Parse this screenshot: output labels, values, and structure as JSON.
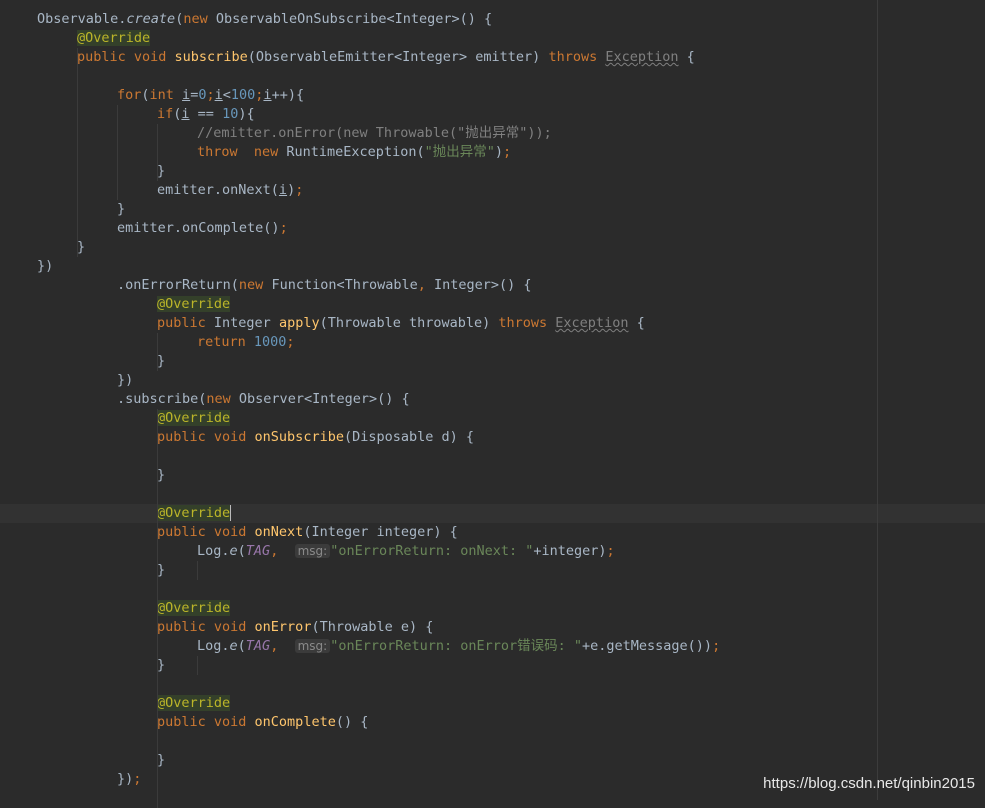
{
  "editor": {
    "lines": [
      {
        "indent": 0,
        "tokens": [
          {
            "t": "cls",
            "s": "Observable."
          },
          {
            "t": "it",
            "s": "create"
          },
          {
            "t": "cls",
            "s": "("
          },
          {
            "t": "kw",
            "s": "new "
          },
          {
            "t": "cls",
            "s": "ObservableOnSubscribe<Integer>() {"
          }
        ]
      },
      {
        "indent": 1,
        "tokens": [
          {
            "t": "ann",
            "s": "@Override"
          }
        ]
      },
      {
        "indent": 1,
        "tokens": [
          {
            "t": "kw",
            "s": "public void "
          },
          {
            "t": "fn",
            "s": "subscribe"
          },
          {
            "t": "cls",
            "s": "(ObservableEmitter<Integer> emitter) "
          },
          {
            "t": "kw",
            "s": "throws "
          },
          {
            "t": "warn",
            "s": "Exception"
          },
          {
            "t": "cls",
            "s": " {"
          }
        ]
      },
      {
        "indent": 0,
        "tokens": []
      },
      {
        "indent": 2,
        "tokens": [
          {
            "t": "kw",
            "s": "for"
          },
          {
            "t": "cls",
            "s": "("
          },
          {
            "t": "kw",
            "s": "int "
          },
          {
            "t": "uvar",
            "s": "i"
          },
          {
            "t": "cls",
            "s": "="
          },
          {
            "t": "num",
            "s": "0"
          },
          {
            "t": "kw",
            "s": ";"
          },
          {
            "t": "uvar",
            "s": "i"
          },
          {
            "t": "cls",
            "s": "<"
          },
          {
            "t": "num",
            "s": "100"
          },
          {
            "t": "kw",
            "s": ";"
          },
          {
            "t": "uvar",
            "s": "i"
          },
          {
            "t": "cls",
            "s": "++){"
          }
        ]
      },
      {
        "indent": 3,
        "tokens": [
          {
            "t": "kw",
            "s": "if"
          },
          {
            "t": "cls",
            "s": "("
          },
          {
            "t": "uvar",
            "s": "i"
          },
          {
            "t": "cls",
            "s": " == "
          },
          {
            "t": "num",
            "s": "10"
          },
          {
            "t": "cls",
            "s": "){"
          }
        ]
      },
      {
        "indent": 4,
        "tokens": [
          {
            "t": "cmt",
            "s": "//emitter.onError(new Throwable(\"抛出异常\"));"
          }
        ]
      },
      {
        "indent": 4,
        "tokens": [
          {
            "t": "kw",
            "s": "throw  new "
          },
          {
            "t": "cls",
            "s": "RuntimeException("
          },
          {
            "t": "str",
            "s": "\"抛出异常\""
          },
          {
            "t": "cls",
            "s": ")"
          },
          {
            "t": "kw",
            "s": ";"
          }
        ]
      },
      {
        "indent": 3,
        "tokens": [
          {
            "t": "cls",
            "s": "}"
          }
        ]
      },
      {
        "indent": 3,
        "tokens": [
          {
            "t": "cls",
            "s": "emitter.onNext("
          },
          {
            "t": "uvar",
            "s": "i"
          },
          {
            "t": "cls",
            "s": ")"
          },
          {
            "t": "kw",
            "s": ";"
          }
        ]
      },
      {
        "indent": 2,
        "tokens": [
          {
            "t": "cls",
            "s": "}"
          }
        ]
      },
      {
        "indent": 2,
        "tokens": [
          {
            "t": "cls",
            "s": "emitter.onComplete()"
          },
          {
            "t": "kw",
            "s": ";"
          }
        ]
      },
      {
        "indent": 1,
        "tokens": [
          {
            "t": "cls",
            "s": "}"
          }
        ]
      },
      {
        "indent": 0,
        "tokens": [
          {
            "t": "cls",
            "s": "})"
          }
        ]
      },
      {
        "indent": 2,
        "tokens": [
          {
            "t": "cls",
            "s": ".onErrorReturn("
          },
          {
            "t": "kw",
            "s": "new "
          },
          {
            "t": "cls",
            "s": "Function<Throwable"
          },
          {
            "t": "kw",
            "s": ", "
          },
          {
            "t": "cls",
            "s": "Integer>() {"
          }
        ]
      },
      {
        "indent": 3,
        "tokens": [
          {
            "t": "ann",
            "s": "@Override"
          }
        ]
      },
      {
        "indent": 3,
        "tokens": [
          {
            "t": "kw",
            "s": "public "
          },
          {
            "t": "cls",
            "s": "Integer "
          },
          {
            "t": "fn",
            "s": "apply"
          },
          {
            "t": "cls",
            "s": "(Throwable throwable) "
          },
          {
            "t": "kw",
            "s": "throws "
          },
          {
            "t": "warn",
            "s": "Exception"
          },
          {
            "t": "cls",
            "s": " {"
          }
        ]
      },
      {
        "indent": 4,
        "tokens": [
          {
            "t": "kw",
            "s": "return "
          },
          {
            "t": "num",
            "s": "1000"
          },
          {
            "t": "kw",
            "s": ";"
          }
        ]
      },
      {
        "indent": 3,
        "tokens": [
          {
            "t": "cls",
            "s": "}"
          }
        ]
      },
      {
        "indent": 2,
        "tokens": [
          {
            "t": "cls",
            "s": "})"
          }
        ]
      },
      {
        "indent": 2,
        "tokens": [
          {
            "t": "cls",
            "s": ".subscribe("
          },
          {
            "t": "kw",
            "s": "new "
          },
          {
            "t": "cls",
            "s": "Observer<Integer>() {"
          }
        ]
      },
      {
        "indent": 3,
        "tokens": [
          {
            "t": "ann",
            "s": "@Override"
          }
        ]
      },
      {
        "indent": 3,
        "tokens": [
          {
            "t": "kw",
            "s": "public void "
          },
          {
            "t": "fn",
            "s": "onSubscribe"
          },
          {
            "t": "cls",
            "s": "(Disposable d) {"
          }
        ]
      },
      {
        "indent": 0,
        "tokens": []
      },
      {
        "indent": 3,
        "tokens": [
          {
            "t": "cls",
            "s": "}"
          }
        ]
      },
      {
        "indent": 0,
        "tokens": []
      },
      {
        "indent": 3,
        "current": true,
        "tokens": [
          {
            "t": "ann",
            "s": "@Override"
          },
          {
            "t": "caret",
            "s": ""
          }
        ]
      },
      {
        "indent": 3,
        "tokens": [
          {
            "t": "kw",
            "s": "public void "
          },
          {
            "t": "fn",
            "s": "onNext"
          },
          {
            "t": "cls",
            "s": "(Integer integer) {"
          }
        ]
      },
      {
        "indent": 4,
        "tokens": [
          {
            "t": "cls",
            "s": "Log."
          },
          {
            "t": "it",
            "s": "e"
          },
          {
            "t": "cls",
            "s": "("
          },
          {
            "t": "field",
            "s": "TAG"
          },
          {
            "t": "kw",
            "s": ",  "
          },
          {
            "t": "hint",
            "s": "msg:"
          },
          {
            "t": "str",
            "s": "\"onErrorReturn: onNext: \""
          },
          {
            "t": "cls",
            "s": "+integer)"
          },
          {
            "t": "kw",
            "s": ";"
          }
        ]
      },
      {
        "indent": 3,
        "tokens": [
          {
            "t": "cls",
            "s": "}"
          }
        ]
      },
      {
        "indent": 0,
        "tokens": []
      },
      {
        "indent": 3,
        "tokens": [
          {
            "t": "ann",
            "s": "@Override"
          }
        ]
      },
      {
        "indent": 3,
        "tokens": [
          {
            "t": "kw",
            "s": "public void "
          },
          {
            "t": "fn",
            "s": "onError"
          },
          {
            "t": "cls",
            "s": "(Throwable e) {"
          }
        ]
      },
      {
        "indent": 4,
        "tokens": [
          {
            "t": "cls",
            "s": "Log."
          },
          {
            "t": "it",
            "s": "e"
          },
          {
            "t": "cls",
            "s": "("
          },
          {
            "t": "field",
            "s": "TAG"
          },
          {
            "t": "kw",
            "s": ",  "
          },
          {
            "t": "hint",
            "s": "msg:"
          },
          {
            "t": "str",
            "s": "\"onErrorReturn: onError错误码: \""
          },
          {
            "t": "cls",
            "s": "+e.getMessage())"
          },
          {
            "t": "kw",
            "s": ";"
          }
        ]
      },
      {
        "indent": 3,
        "tokens": [
          {
            "t": "cls",
            "s": "}"
          }
        ]
      },
      {
        "indent": 0,
        "tokens": []
      },
      {
        "indent": 3,
        "tokens": [
          {
            "t": "ann",
            "s": "@Override"
          }
        ]
      },
      {
        "indent": 3,
        "tokens": [
          {
            "t": "kw",
            "s": "public void "
          },
          {
            "t": "fn",
            "s": "onComplete"
          },
          {
            "t": "cls",
            "s": "() {"
          }
        ]
      },
      {
        "indent": 0,
        "tokens": []
      },
      {
        "indent": 3,
        "tokens": [
          {
            "t": "cls",
            "s": "}"
          }
        ]
      },
      {
        "indent": 2,
        "tokens": [
          {
            "t": "cls",
            "s": "})"
          },
          {
            "t": "kw",
            "s": ";"
          }
        ]
      }
    ]
  },
  "watermark": "https://blog.csdn.net/qinbin2015",
  "colors": {
    "background": "#2b2b2b",
    "keyword": "#cc7832",
    "annotation": "#bbb529",
    "method": "#ffc66d",
    "number": "#6897bb",
    "string": "#6a8759",
    "comment": "#808080"
  }
}
